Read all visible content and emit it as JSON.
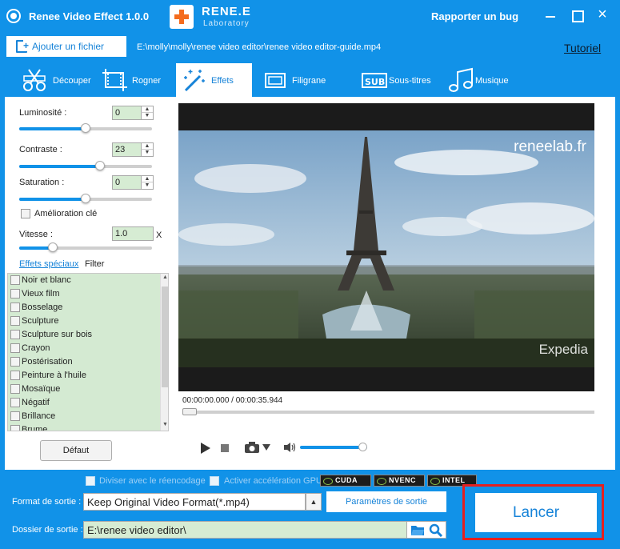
{
  "window": {
    "title": "Renee Video Effect 1.0.0",
    "brand_name": "RENE.E",
    "brand_sub": "Laboratory",
    "report_bug": "Rapporter un bug",
    "close_glyph": "×"
  },
  "file": {
    "add_label": "Ajouter un fichier",
    "path": "E:\\molly\\molly\\renee video editor\\renee video editor-guide.mp4",
    "tutorial": "Tutoriel"
  },
  "tabs": [
    {
      "label": "Découper",
      "icon": "scissors-icon",
      "active": false
    },
    {
      "label": "Rogner",
      "icon": "crop-film-icon",
      "active": false
    },
    {
      "label": "Effets",
      "icon": "magic-wand-icon",
      "active": true
    },
    {
      "label": "Filigrane",
      "icon": "watermark-icon",
      "active": false
    },
    {
      "label": "Sous-titres",
      "icon": "subtitle-icon",
      "active": false
    },
    {
      "label": "Musique",
      "icon": "music-note-icon",
      "active": false
    }
  ],
  "effects": {
    "brightness": {
      "label": "Luminosité :",
      "value": "0",
      "level": 0.5
    },
    "contrast": {
      "label": "Contraste :",
      "value": "23",
      "level": 0.61
    },
    "saturation": {
      "label": "Saturation :",
      "value": "0",
      "level": 0.5
    },
    "enhance": {
      "label": "Amélioration clé",
      "checked": false
    },
    "speed": {
      "label": "Vitesse :",
      "value": "1.0",
      "unit": "X",
      "level": 0.25
    },
    "tab_special": "Effets spéciaux",
    "tab_filter": "Filter",
    "filters": [
      "Noir et blanc",
      "Vieux film",
      "Bosselage",
      "Sculpture",
      "Sculpture sur bois",
      "Crayon",
      "Postérisation",
      "Peinture à l'huile",
      "Mosaïque",
      "Négatif",
      "Brillance",
      "Brume"
    ],
    "default_button": "Défaut",
    "spin_up": "▲",
    "spin_down": "▼"
  },
  "player": {
    "watermark_top": "reneelab.fr",
    "watermark_bottom": "Expedia",
    "time_current": "00:00:00.000",
    "time_separator": " / ",
    "time_total": "00:00:35.944",
    "volume_level": 0.93
  },
  "output": {
    "split_label": "Diviser avec le réencodage",
    "gpu_label": "Activer accélération GPU",
    "gpu_chips": [
      "CUDA",
      "NVENC",
      "INTEL"
    ],
    "format_label": "Format de sortie :",
    "format_value": "Keep Original Video Format(*.mp4)",
    "format_arrow": "▲",
    "params_button": "Paramètres de sortie",
    "folder_label": "Dossier de sortie :",
    "folder_value": "E:\\renee video editor\\",
    "launch_button": "Lancer"
  },
  "colors": {
    "accent": "#1192e8",
    "highlight_outline": "#e52020",
    "input_green": "#d6ecd3"
  }
}
